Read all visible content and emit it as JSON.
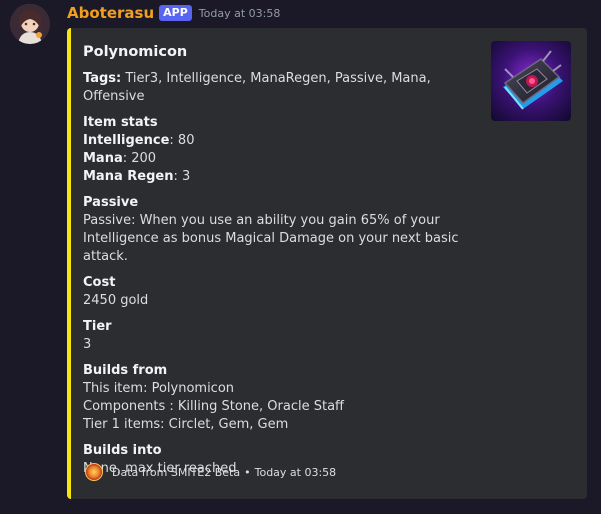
{
  "message": {
    "username": "Aboterasu",
    "badge": "APP",
    "timestamp": "Today at 03:58"
  },
  "embed": {
    "accent_color": "#f5e50a",
    "title": "Polynomicon",
    "tags_label": "Tags",
    "tags_value": "Tier3, Intelligence, ManaRegen, Passive, Mana, Offensive",
    "item_stats": {
      "name": "Item stats",
      "stats": [
        {
          "label": "Intelligence",
          "value": "80"
        },
        {
          "label": "Mana",
          "value": "200"
        },
        {
          "label": "Mana Regen",
          "value": "3"
        }
      ]
    },
    "passive": {
      "name": "Passive",
      "value": "Passive: When you use an ability you gain 65% of your Intelligence as bonus Magical Damage on your next basic attack."
    },
    "cost": {
      "name": "Cost",
      "value": "2450 gold"
    },
    "tier": {
      "name": "Tier",
      "value": "3"
    },
    "builds_from": {
      "name": "Builds from",
      "lines": [
        "This item: Polynomicon",
        "Components : Killing Stone, Oracle Staff",
        "Tier 1 items: Circlet, Gem, Gem"
      ]
    },
    "builds_into": {
      "name": "Builds into",
      "value": "None, max tier reached"
    },
    "footer": {
      "text": "Data from SMITE2 Beta",
      "separator": "•",
      "timestamp": "Today at 03:58"
    },
    "thumbnail_icon": "polynomicon-book-icon"
  }
}
